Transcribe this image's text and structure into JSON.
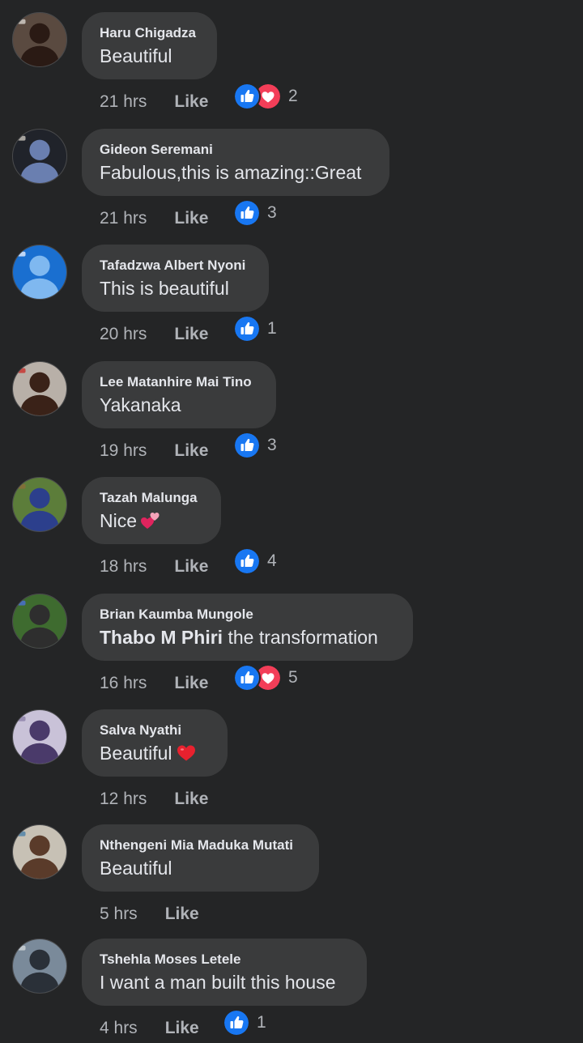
{
  "colors": {
    "background": "#242526",
    "bubble": "#3a3b3c",
    "text_primary": "#e4e6eb",
    "text_secondary": "#b0b3b8",
    "like_blue": "#1877f2",
    "love_red": "#f33e58"
  },
  "comments": [
    {
      "author": "Haru Chigadza",
      "text": "Beautiful",
      "time": "21 hrs",
      "like_label": "Like",
      "reactions": [
        "like",
        "love"
      ],
      "reaction_count": "2"
    },
    {
      "author": "Gideon Seremani",
      "text": "Fabulous,this is amazing::Great",
      "time": "21 hrs",
      "like_label": "Like",
      "reactions": [
        "like"
      ],
      "reaction_count": "3"
    },
    {
      "author": "Tafadzwa Albert Nyoni",
      "text": "This is beautiful",
      "time": "20 hrs",
      "like_label": "Like",
      "reactions": [
        "like"
      ],
      "reaction_count": "1"
    },
    {
      "author": "Lee Matanhire Mai Tino",
      "text": "Yakanaka",
      "time": "19 hrs",
      "like_label": "Like",
      "reactions": [
        "like"
      ],
      "reaction_count": "3"
    },
    {
      "author": "Tazah Malunga",
      "text": "Nice",
      "emoji": "two-hearts-icon",
      "time": "18 hrs",
      "like_label": "Like",
      "reactions": [
        "like"
      ],
      "reaction_count": "4"
    },
    {
      "author": "Brian Kaumba Mungole",
      "mention": "Thabo M Phiri",
      "text": " the transformation",
      "time": "16 hrs",
      "like_label": "Like",
      "reactions": [
        "like",
        "love"
      ],
      "reaction_count": "5"
    },
    {
      "author": "Salva Nyathi",
      "text": "Beautiful",
      "emoji": "red-heart-icon",
      "time": "12 hrs",
      "like_label": "Like",
      "reactions": [],
      "reaction_count": ""
    },
    {
      "author": "Nthengeni Mia Maduka Mutati",
      "text": "Beautiful",
      "time": "5 hrs",
      "like_label": "Like",
      "reactions": [],
      "reaction_count": ""
    },
    {
      "author": "Tshehla Moses Letele",
      "text": "I want a man built this house",
      "time": "4 hrs",
      "like_label": "Like",
      "reactions": [
        "like"
      ],
      "reaction_count": "1"
    }
  ]
}
